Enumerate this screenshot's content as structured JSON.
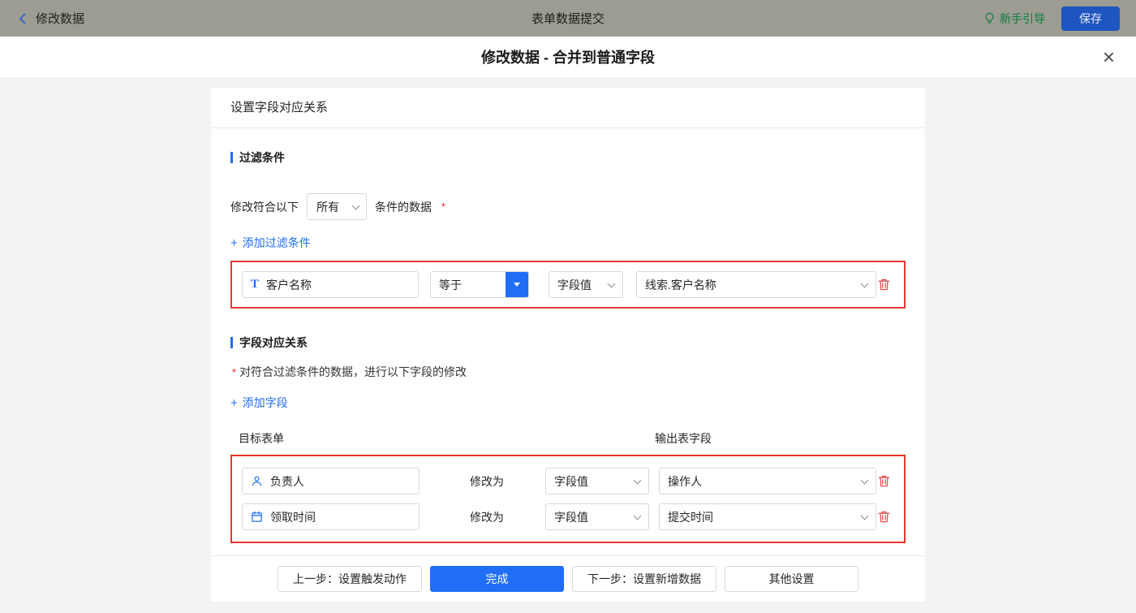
{
  "topbar": {
    "back_label": "修改数据",
    "title": "表单数据提交",
    "guide_label": "新手引导",
    "save_label": "保存"
  },
  "modal": {
    "title": "修改数据 - 合并到普通字段",
    "close_icon": "×"
  },
  "card": {
    "header": "设置字段对应关系",
    "filter": {
      "section_title": "过滤条件",
      "prefix": "修改符合以下",
      "match_select": "所有",
      "suffix": "条件的数据",
      "required": "*",
      "add_icon": "+",
      "add_label": "添加过滤条件",
      "row": {
        "field_icon_glyph": "T",
        "field": "客户名称",
        "operator": "等于",
        "value_type": "字段值",
        "value": "线索.客户名称"
      }
    },
    "mapping": {
      "section_title": "字段对应关系",
      "required": "*",
      "description": "对符合过滤条件的数据，进行以下字段的修改",
      "add_icon": "+",
      "add_label": "添加字段",
      "column_left": "目标表单",
      "column_right": "输出表字段",
      "rows": [
        {
          "field": "负责人",
          "modify_label": "修改为",
          "value_type": "字段值",
          "value": "操作人"
        },
        {
          "field": "领取时间",
          "modify_label": "修改为",
          "value_type": "字段值",
          "value": "提交时间"
        }
      ]
    },
    "footer": {
      "prev": "上一步：设置触发动作",
      "done": "完成",
      "next": "下一步：设置新增数据",
      "other": "其他设置"
    }
  },
  "colors": {
    "accent_blue": "#1f6ef5",
    "highlight_red": "#e8352b",
    "success_green": "#0f7d3f",
    "danger_red": "#f5222d"
  }
}
